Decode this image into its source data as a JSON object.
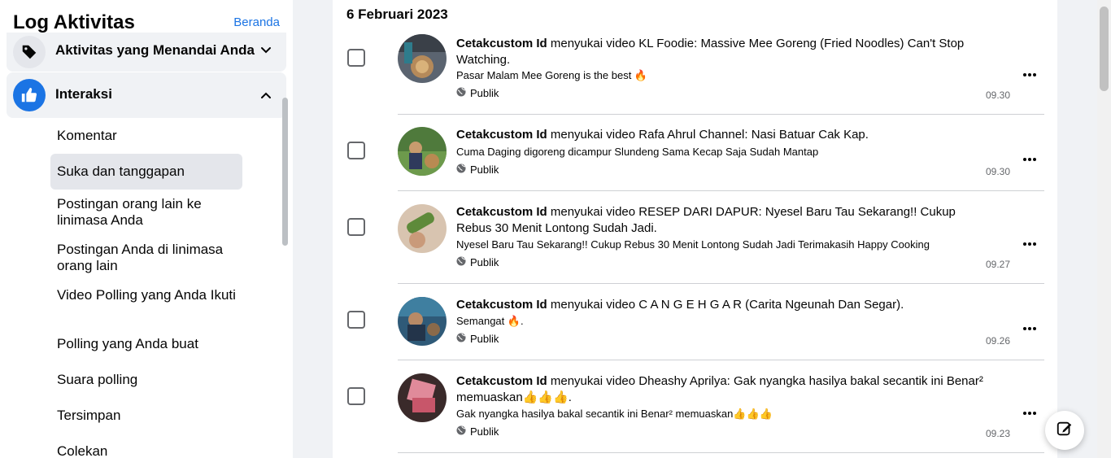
{
  "sidebar": {
    "title": "Log Aktivitas",
    "home_link": "Beranda",
    "groups": [
      {
        "label": "Aktivitas yang Menandai Anda",
        "icon": "tag-icon",
        "expanded": false
      },
      {
        "label": "Interaksi",
        "icon": "thumbs-up-icon",
        "expanded": true
      }
    ],
    "items": [
      {
        "label": "Komentar",
        "active": false
      },
      {
        "label": "Suka dan tanggapan",
        "active": true
      },
      {
        "label": "Postingan orang lain ke linimasa Anda",
        "active": false
      },
      {
        "label": "Postingan Anda di linimasa orang lain",
        "active": false
      },
      {
        "label": "Video Polling yang Anda Ikuti",
        "active": false
      },
      {
        "label": "Polling yang Anda buat",
        "active": false
      },
      {
        "label": "Suara polling",
        "active": false
      },
      {
        "label": "Tersimpan",
        "active": false
      },
      {
        "label": "Colekan",
        "active": false
      }
    ]
  },
  "main": {
    "date_header": "6 Februari 2023",
    "activities": [
      {
        "actor": "Cetakcustom Id",
        "verb": "menyukai",
        "object_type": "video",
        "target": "KL Foodie: Massive Mee Goreng (Fried Noodles) Can't Stop Watching.",
        "target_suffix": "",
        "caption": "Pasar Malam Mee Goreng is the best 🔥",
        "audience": "Publik",
        "time": "09.30"
      },
      {
        "actor": "Cetakcustom Id",
        "verb": "menyukai",
        "object_type": "video",
        "target": "Rafa Ahrul Channel: Nasi Batuar Cak Kap.",
        "target_suffix": "",
        "caption": "Cuma Daging digoreng dicampur Slundeng Sama Kecap Saja Sudah Mantap",
        "audience": "Publik",
        "time": "09.30"
      },
      {
        "actor": "Cetakcustom Id",
        "verb": "menyukai",
        "object_type": "video",
        "target": "RESEP DARI DAPUR: Nyesel Baru Tau Sekarang!! Cukup Rebus 30 Menit Lontong Sudah Jadi.",
        "target_suffix": "",
        "caption": "Nyesel Baru Tau Sekarang!! Cukup Rebus 30 Menit Lontong Sudah Jadi Terimakasih Happy Cooking",
        "audience": "Publik",
        "time": "09.27"
      },
      {
        "actor": "Cetakcustom Id",
        "verb": "menyukai",
        "object_type": "video",
        "target": "C A N G E H G A R",
        "target_suffix": " (Carita Ngeunah Dan Segar).",
        "caption": "Semangat 🔥.",
        "audience": "Publik",
        "time": "09.26"
      },
      {
        "actor": "Cetakcustom Id",
        "verb": "menyukai",
        "object_type": "video",
        "target": "Dheashy Aprilya: Gak nyangka hasilya bakal secantik ini Benar² memuaskan👍👍👍.",
        "target_suffix": "",
        "caption": "Gak nyangka hasilya bakal secantik ini Benar² memuaskan👍👍👍",
        "audience": "Publik",
        "time": "09.23"
      }
    ]
  },
  "colors": {
    "accent": "#1b74e4",
    "page_bg": "#f0f2f5",
    "card_bg": "#ffffff",
    "secondary_text": "#65676b"
  }
}
